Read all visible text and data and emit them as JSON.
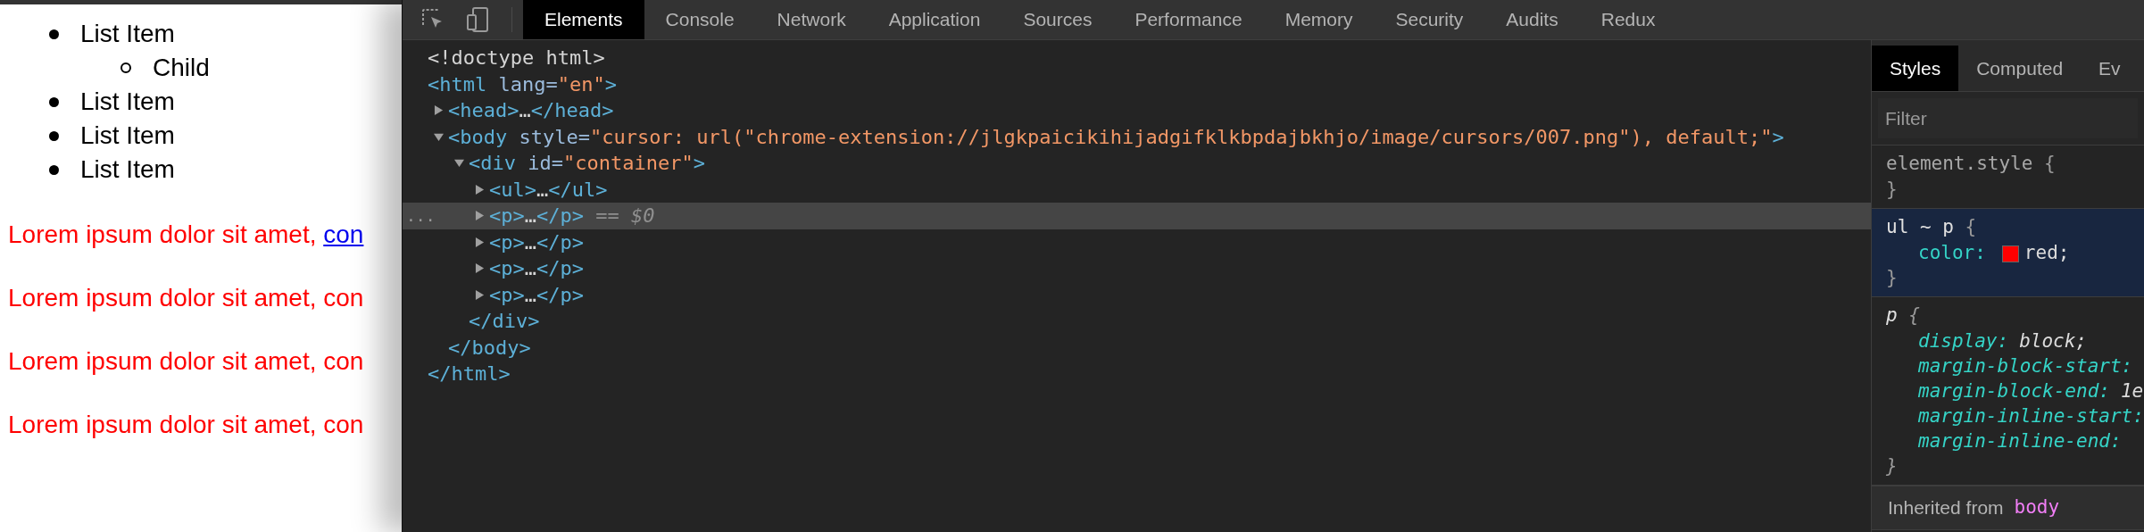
{
  "page": {
    "list": [
      {
        "text": "List Item",
        "children": [
          {
            "text": "Child"
          }
        ]
      },
      {
        "text": "List Item"
      },
      {
        "text": "List Item"
      },
      {
        "text": "List Item"
      }
    ],
    "paragraphs": [
      {
        "text": "Lorem ipsum dolor sit amet, ",
        "link": "con"
      },
      {
        "text": "Lorem ipsum dolor sit amet, con"
      },
      {
        "text": "Lorem ipsum dolor sit amet, con"
      },
      {
        "text": "Lorem ipsum dolor sit amet, con"
      }
    ]
  },
  "devtools": {
    "tabs": [
      {
        "label": "Elements",
        "selected": true
      },
      {
        "label": "Console",
        "selected": false
      },
      {
        "label": "Network",
        "selected": false
      },
      {
        "label": "Application",
        "selected": false
      },
      {
        "label": "Sources",
        "selected": false
      },
      {
        "label": "Performance",
        "selected": false
      },
      {
        "label": "Memory",
        "selected": false
      },
      {
        "label": "Security",
        "selected": false
      },
      {
        "label": "Audits",
        "selected": false
      },
      {
        "label": "Redux",
        "selected": false
      }
    ],
    "elements": {
      "nodes": [
        {
          "selected": false,
          "parts": [
            {
              "kind": "text",
              "text": "<!doctype html>"
            }
          ]
        },
        {
          "selected": false,
          "parts": [
            {
              "kind": "tag",
              "text": "<html"
            },
            {
              "kind": "attr",
              "text": " lang="
            },
            {
              "kind": "value",
              "text": "\"en\""
            },
            {
              "kind": "tag",
              "text": ">"
            }
          ],
          "close": [
            {
              "kind": "tag",
              "text": "</html>"
            }
          ],
          "children": [
            {
              "selected": false,
              "expanded": false,
              "parts": [
                {
                  "kind": "tag",
                  "text": "<head>"
                },
                {
                  "kind": "text",
                  "text": "…"
                },
                {
                  "kind": "tag",
                  "text": "</head>"
                }
              ]
            },
            {
              "selected": false,
              "expanded": true,
              "parts": [
                {
                  "kind": "tag",
                  "text": "<body"
                },
                {
                  "kind": "attr",
                  "text": " style="
                },
                {
                  "kind": "value",
                  "text": "\"cursor: url(\"chrome-extension://jlgkpaicikihijadgifklkbpdajbkhjo/image/cursors/007.png\"), default;\""
                },
                {
                  "kind": "tag",
                  "text": ">"
                }
              ],
              "close": [
                {
                  "kind": "tag",
                  "text": "</body>"
                }
              ],
              "children": [
                {
                  "selected": false,
                  "expanded": true,
                  "parts": [
                    {
                      "kind": "tag",
                      "text": "<div"
                    },
                    {
                      "kind": "attr",
                      "text": " id="
                    },
                    {
                      "kind": "value",
                      "text": "\"container\""
                    },
                    {
                      "kind": "tag",
                      "text": ">"
                    }
                  ],
                  "close": [
                    {
                      "kind": "tag",
                      "text": "</div>"
                    }
                  ],
                  "children": [
                    {
                      "selected": false,
                      "expanded": false,
                      "parts": [
                        {
                          "kind": "tag",
                          "text": "<ul>"
                        },
                        {
                          "kind": "text",
                          "text": "…"
                        },
                        {
                          "kind": "tag",
                          "text": "</ul>"
                        }
                      ]
                    },
                    {
                      "selected": true,
                      "expanded": false,
                      "gutter": "...",
                      "parts": [
                        {
                          "kind": "tag",
                          "text": "<p>"
                        },
                        {
                          "kind": "text",
                          "text": "…"
                        },
                        {
                          "kind": "tag",
                          "text": "</p>"
                        },
                        {
                          "kind": "hint",
                          "text": " == $0"
                        }
                      ]
                    },
                    {
                      "selected": false,
                      "expanded": false,
                      "parts": [
                        {
                          "kind": "tag",
                          "text": "<p>"
                        },
                        {
                          "kind": "text",
                          "text": "…"
                        },
                        {
                          "kind": "tag",
                          "text": "</p>"
                        }
                      ]
                    },
                    {
                      "selected": false,
                      "expanded": false,
                      "parts": [
                        {
                          "kind": "tag",
                          "text": "<p>"
                        },
                        {
                          "kind": "text",
                          "text": "…"
                        },
                        {
                          "kind": "tag",
                          "text": "</p>"
                        }
                      ]
                    },
                    {
                      "selected": false,
                      "expanded": false,
                      "parts": [
                        {
                          "kind": "tag",
                          "text": "<p>"
                        },
                        {
                          "kind": "text",
                          "text": "…"
                        },
                        {
                          "kind": "tag",
                          "text": "</p>"
                        }
                      ]
                    }
                  ]
                }
              ]
            }
          ]
        }
      ]
    },
    "sidebar": {
      "tabs": [
        {
          "label": "Styles",
          "selected": true
        },
        {
          "label": "Computed",
          "selected": false
        },
        {
          "label": "Ev",
          "selected": false
        }
      ],
      "filter": {
        "placeholder": "Filter"
      },
      "rules": [
        {
          "kind": "inline",
          "highlighted": false,
          "selector": "element.style",
          "open": "{",
          "close": "}"
        },
        {
          "kind": "author",
          "highlighted": true,
          "selector": "ul ~ p",
          "open": "{",
          "close": "}",
          "declarations": [
            {
              "property": "color:",
              "value": "red;",
              "color": "#ff0000"
            }
          ]
        },
        {
          "kind": "user-agent",
          "highlighted": false,
          "selector": "p",
          "open": "{",
          "close": "}",
          "declarations": [
            {
              "property": "display:",
              "value": "block;"
            },
            {
              "property": "margin-block-start:"
            },
            {
              "property": "margin-block-end:",
              "value": "1e"
            },
            {
              "property": "margin-inline-start:"
            },
            {
              "property": "margin-inline-end:"
            }
          ]
        }
      ],
      "inherited": {
        "label": "Inherited from",
        "element": "body"
      }
    }
  }
}
